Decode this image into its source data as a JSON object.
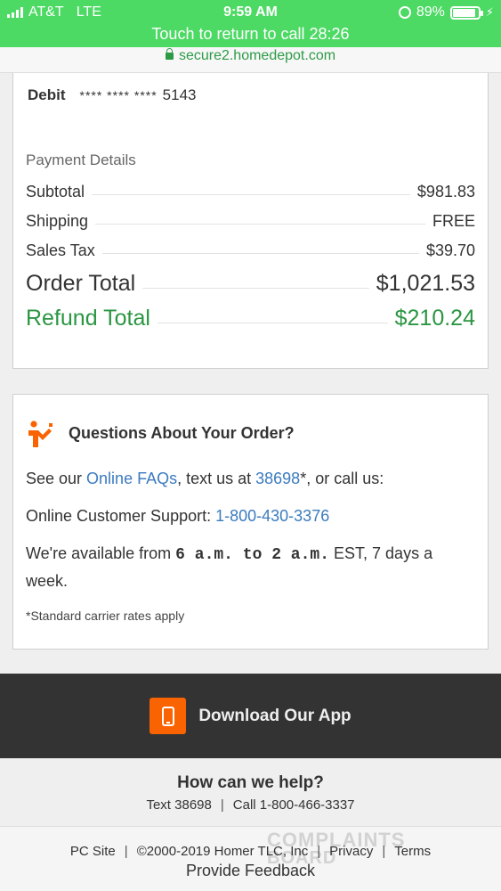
{
  "status_bar": {
    "carrier": "AT&T",
    "network": "LTE",
    "time": "9:59 AM",
    "battery_percent": "89%",
    "battery_level": 0.89
  },
  "call_banner": "Touch to return to call 28:26",
  "url": "secure2.homedepot.com",
  "payment": {
    "method_label": "Debit",
    "masked_number": "**** **** ****",
    "last4": "5143",
    "details_title": "Payment Details",
    "lines": [
      {
        "label": "Subtotal",
        "value": "$981.83"
      },
      {
        "label": "Shipping",
        "value": "FREE"
      },
      {
        "label": "Sales Tax",
        "value": "$39.70"
      }
    ],
    "order_total_label": "Order Total",
    "order_total_value": "$1,021.53",
    "refund_total_label": "Refund Total",
    "refund_total_value": "$210.24"
  },
  "questions": {
    "title": "Questions About Your Order?",
    "faq_prefix": "See our ",
    "faq_link": "Online FAQs",
    "faq_mid": ", text us at ",
    "text_number": "38698",
    "faq_suffix": "*, or call us:",
    "support_label": "Online Customer Support: ",
    "support_phone": "1-800-430-3376",
    "hours_prefix": "We're available from ",
    "hours_start": "6 a.m.",
    "hours_to": " to ",
    "hours_end": "2 a.m.",
    "hours_suffix": " EST, 7 days a week.",
    "fine_print": "*Standard carrier rates apply"
  },
  "app_banner": {
    "label": "Download Our App"
  },
  "help": {
    "title": "How can we help?",
    "text": "Text 38698",
    "call": "Call 1-800-466-3337"
  },
  "footer": {
    "pc_site": "PC Site",
    "copyright": "©2000-2019 Homer TLC, Inc",
    "privacy": "Privacy",
    "terms": "Terms",
    "feedback": "Provide Feedback"
  },
  "watermark": {
    "line1": "COMPLAINTS",
    "line2": "BOARD"
  },
  "colors": {
    "status_green": "#4cd964",
    "hd_orange": "#f96302",
    "refund_green": "#2b9642",
    "link_blue": "#3b7bbf"
  }
}
